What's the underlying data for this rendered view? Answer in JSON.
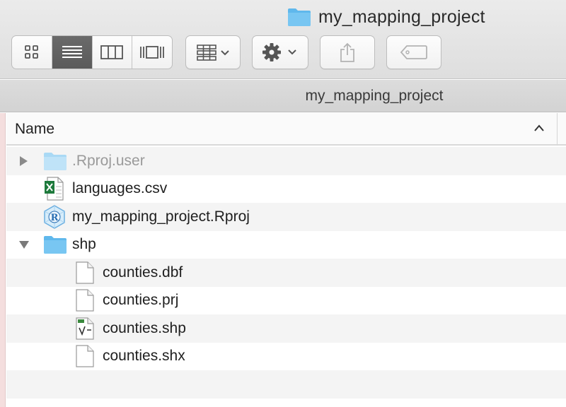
{
  "window": {
    "title": "my_mapping_project"
  },
  "toolbar": {
    "view_buttons": [
      {
        "name": "icon-view",
        "icon": "grid-icon",
        "active": false
      },
      {
        "name": "list-view",
        "icon": "list-icon",
        "active": true
      },
      {
        "name": "column-view",
        "icon": "columns-icon",
        "active": false
      },
      {
        "name": "gallery-view",
        "icon": "gallery-icon",
        "active": false
      }
    ],
    "arrange_icon": "arrange-icon",
    "action_icon": "gear-icon",
    "share_icon": "share-icon",
    "tag_icon": "tag-icon"
  },
  "pathbar": {
    "text": "my_mapping_project"
  },
  "columns": {
    "name": "Name",
    "sort": "ascending"
  },
  "files": [
    {
      "name": ".Rproj.user",
      "kind": "folder",
      "level": 0,
      "expanded": false,
      "dim": true
    },
    {
      "name": "languages.csv",
      "kind": "csv",
      "level": 0
    },
    {
      "name": "my_mapping_project.Rproj",
      "kind": "rproj",
      "level": 0
    },
    {
      "name": "shp",
      "kind": "folder",
      "level": 0,
      "expanded": true
    },
    {
      "name": "counties.dbf",
      "kind": "doc",
      "level": 1
    },
    {
      "name": "counties.prj",
      "kind": "doc",
      "level": 1
    },
    {
      "name": "counties.shp",
      "kind": "shp",
      "level": 1
    },
    {
      "name": "counties.shx",
      "kind": "doc",
      "level": 1
    }
  ],
  "colors": {
    "folder": "#5fb8ec",
    "active_segment": "#616161"
  }
}
